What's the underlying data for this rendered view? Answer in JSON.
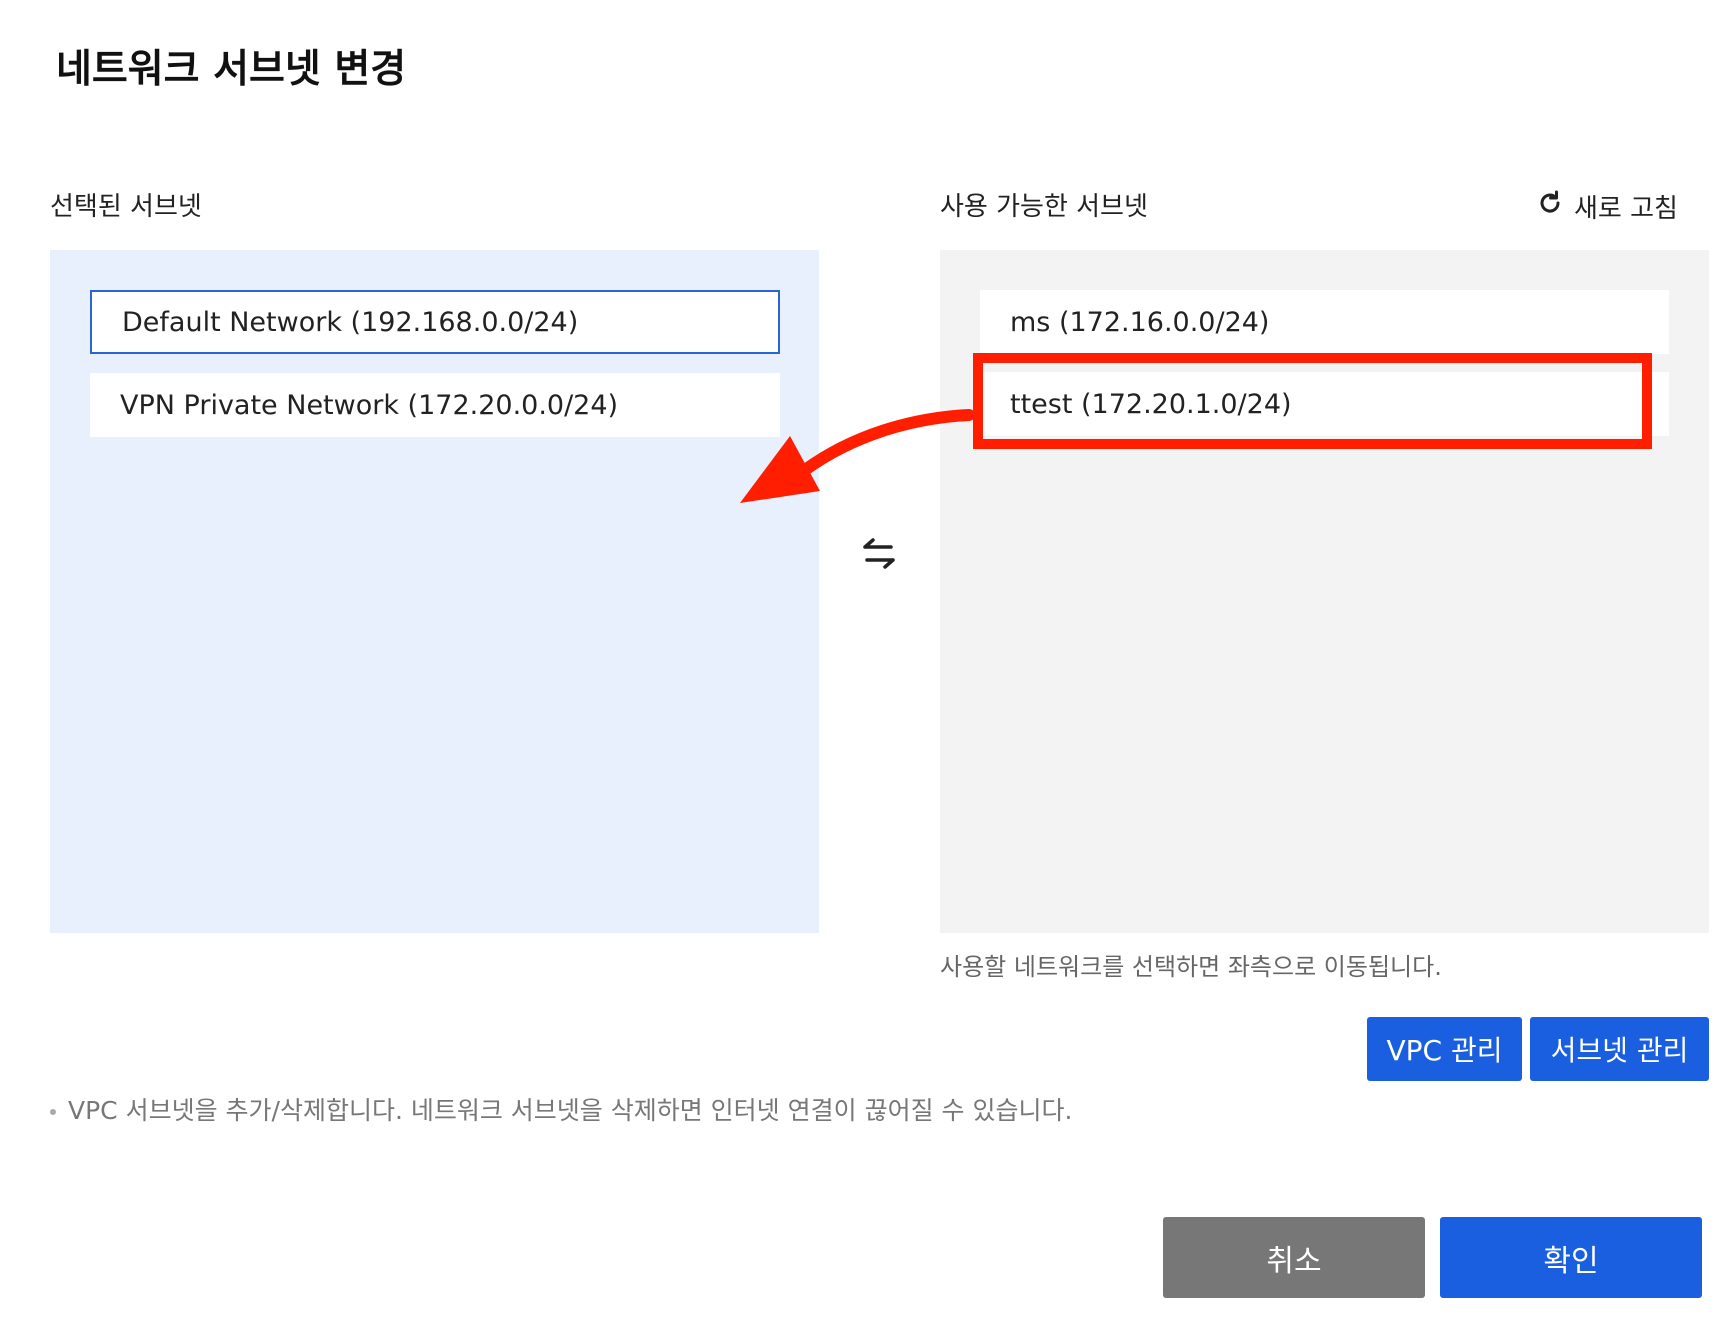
{
  "dialog": {
    "title": "네트워크 서브넷 변경"
  },
  "selected": {
    "label": "선택된 서브넷",
    "items": [
      {
        "label": "Default Network (192.168.0.0/24)"
      },
      {
        "label": "VPN Private Network (172.20.0.0/24)"
      }
    ]
  },
  "available": {
    "label": "사용 가능한 서브넷",
    "refresh_label": "새로 고침",
    "items": [
      {
        "label": "ms (172.16.0.0/24)"
      },
      {
        "label": "ttest (172.20.1.0/24)"
      }
    ],
    "hint": "사용할 네트워크를 선택하면 좌측으로 이동됩니다."
  },
  "manage_buttons": {
    "vpc": "VPC 관리",
    "subnet": "서브넷 관리"
  },
  "note": "VPC 서브넷을 추가/삭제합니다. 네트워크 서브넷을 삭제하면 인터넷 연결이 끊어질 수 있습니다.",
  "footer": {
    "cancel": "취소",
    "confirm": "확인"
  },
  "colors": {
    "primary": "#1a5fe0",
    "selected_bg": "#e8f0fd",
    "available_bg": "#f3f3f3",
    "annotation": "#ff1e00"
  },
  "icons": {
    "refresh": "refresh-icon",
    "swap": "swap-arrows-icon"
  }
}
